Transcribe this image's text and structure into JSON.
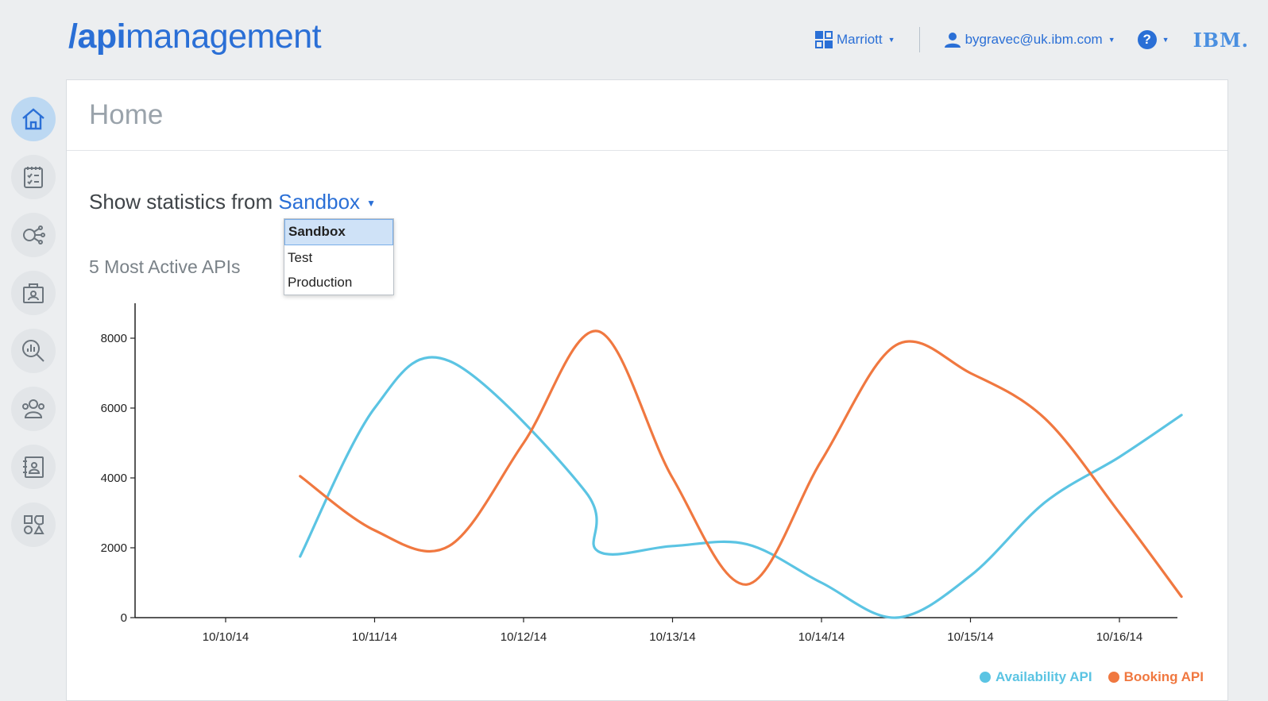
{
  "app": {
    "logo_slash": "/",
    "logo_bold": "api",
    "logo_rest": "management",
    "brand_color": "#2a6fd6"
  },
  "topnav": {
    "org_label": "Marriott",
    "org_icon": "org-grid-icon",
    "user_label": "bygravec@uk.ibm.com",
    "user_icon": "user-icon",
    "help_label": "?",
    "vendor_logo": "IBM."
  },
  "sidebar": {
    "items": [
      {
        "name": "home",
        "icon": "home-icon",
        "active": true
      },
      {
        "name": "plans",
        "icon": "checklist-icon",
        "active": false
      },
      {
        "name": "apis",
        "icon": "api-nodes-icon",
        "active": false
      },
      {
        "name": "products",
        "icon": "briefcase-icon",
        "active": false
      },
      {
        "name": "analytics",
        "icon": "analytics-search-icon",
        "active": false
      },
      {
        "name": "developers",
        "icon": "users-icon",
        "active": false
      },
      {
        "name": "portal",
        "icon": "contact-book-icon",
        "active": false
      },
      {
        "name": "settings",
        "icon": "shapes-icon",
        "active": false
      }
    ]
  },
  "main": {
    "title": "Home",
    "stat_prefix": "Show statistics from",
    "env_selected": "Sandbox",
    "env_options": [
      "Sandbox",
      "Test",
      "Production"
    ],
    "section_label": "5 Most Active APIs"
  },
  "chart_data": {
    "type": "line",
    "x": [
      "10/10/14",
      "10/11/14",
      "10/12/14",
      "10/13/14",
      "10/14/14",
      "10/15/14",
      "10/16/14"
    ],
    "ylim": [
      0,
      9000
    ],
    "yticks": [
      0,
      2000,
      4000,
      6000,
      8000
    ],
    "series": [
      {
        "name": "Availability API",
        "color": "#5bc4e3",
        "points": [
          [
            "10/10/14 12:00",
            1750
          ],
          [
            "10/11/14",
            6000
          ],
          [
            "10/11/14 12:00",
            7350
          ],
          [
            "10/12/14 10:00",
            3600
          ],
          [
            "10/12/14 12:00",
            1900
          ],
          [
            "10/13/14",
            2050
          ],
          [
            "10/13/14 12:00",
            2100
          ],
          [
            "10/14/14",
            1000
          ],
          [
            "10/14/14 12:00",
            0
          ],
          [
            "10/15/14",
            1200
          ],
          [
            "10/15/14 12:00",
            3300
          ],
          [
            "10/16/14",
            4600
          ],
          [
            "10/16/14 10:00",
            5800
          ]
        ]
      },
      {
        "name": "Booking API",
        "color": "#f07840",
        "points": [
          [
            "10/10/14 12:00",
            4050
          ],
          [
            "10/11/14",
            2500
          ],
          [
            "10/11/14 12:00",
            2050
          ],
          [
            "10/12/14",
            5000
          ],
          [
            "10/12/14 12:00",
            8200
          ],
          [
            "10/13/14",
            4000
          ],
          [
            "10/13/14 12:00",
            950
          ],
          [
            "10/14/14",
            4500
          ],
          [
            "10/14/14 12:00",
            7800
          ],
          [
            "10/15/14",
            7000
          ],
          [
            "10/15/14 12:00",
            5700
          ],
          [
            "10/16/14",
            3000
          ],
          [
            "10/16/14 10:00",
            600
          ]
        ]
      }
    ],
    "legend": "bottom-right"
  }
}
